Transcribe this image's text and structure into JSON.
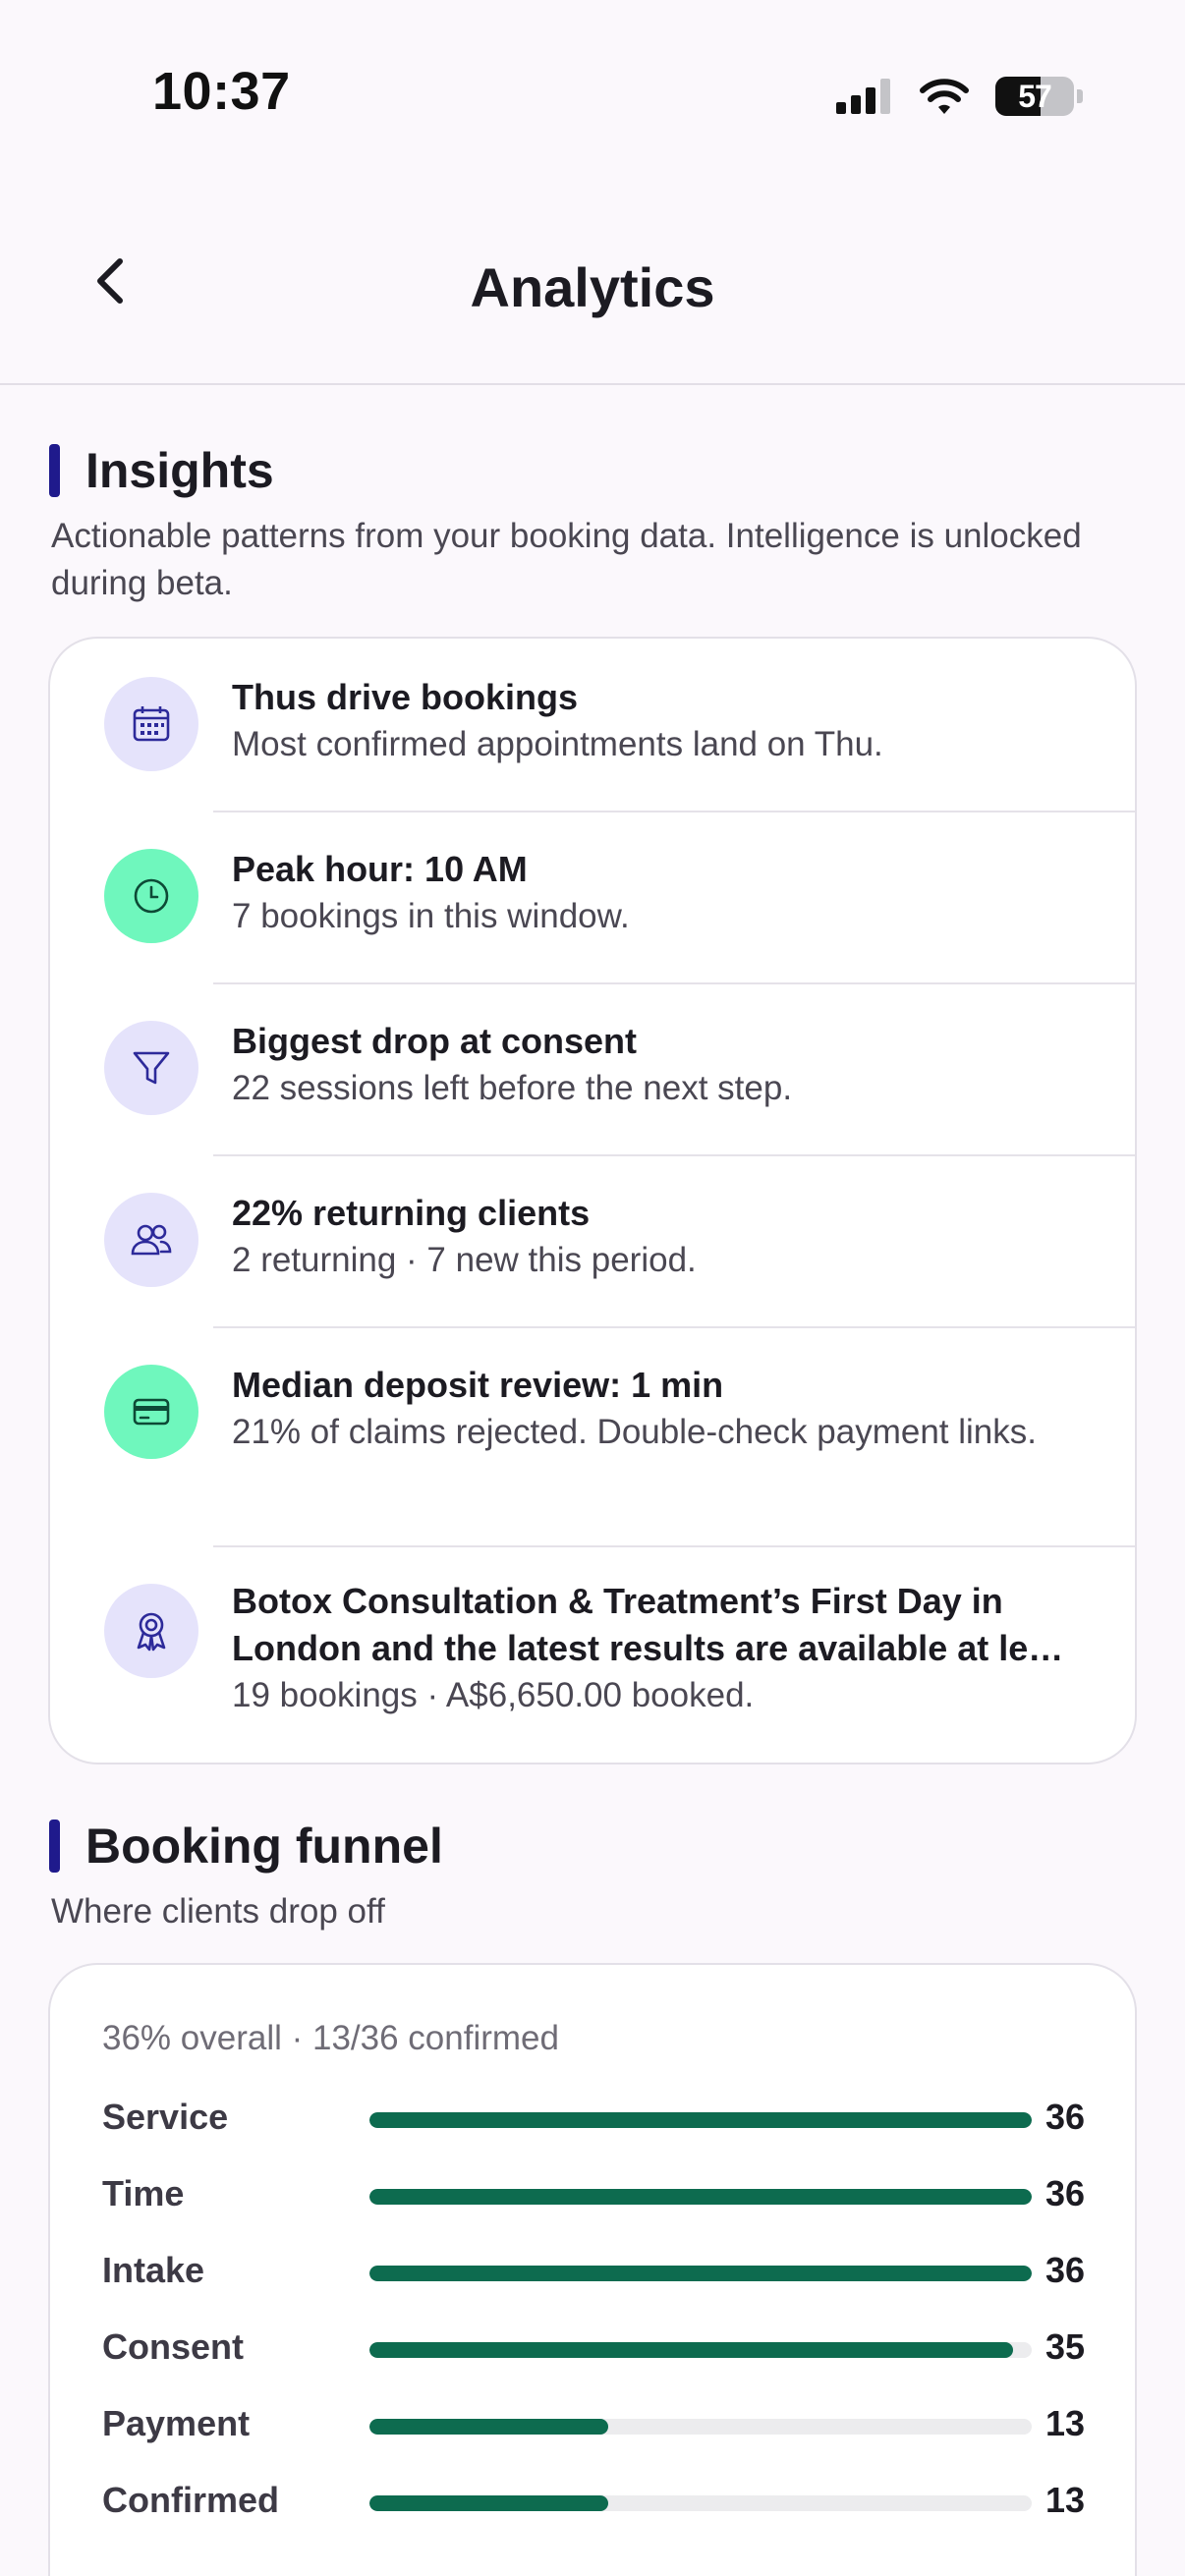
{
  "status_bar": {
    "time": "10:37",
    "battery": "57",
    "battery_level": 57
  },
  "header": {
    "title": "Analytics",
    "back_icon": "chevron-left-icon"
  },
  "insights": {
    "title": "Insights",
    "subtitle": "Actionable patterns from your booking data. Intelligence is unlocked during beta.",
    "items": [
      {
        "icon": "calendar-icon",
        "icon_bg": "lavender",
        "title": "Thus drive bookings",
        "body": "Most confirmed appointments land on Thu."
      },
      {
        "icon": "clock-icon",
        "icon_bg": "mint",
        "title": "Peak hour: 10 AM",
        "body": "7 bookings in this window."
      },
      {
        "icon": "funnel-icon",
        "icon_bg": "lavender",
        "title": "Biggest drop at consent",
        "body": "22 sessions left before the next step."
      },
      {
        "icon": "users-icon",
        "icon_bg": "lavender",
        "title": "22% returning clients",
        "body": "2 returning · 7 new this period."
      },
      {
        "icon": "credit-card-icon",
        "icon_bg": "mint",
        "title": "Median deposit review: 1 min",
        "body": "21% of claims rejected. Double-check payment links."
      },
      {
        "icon": "award-icon",
        "icon_bg": "lavender",
        "title": "Botox Consultation & Treatment’s First Day in London and the latest results are available at le…",
        "body": "19 bookings · A$6,650.00 booked."
      }
    ]
  },
  "funnel": {
    "title": "Booking funnel",
    "subtitle": "Where clients drop off",
    "summary": "36% overall · 13/36 confirmed",
    "max": 36,
    "steps": [
      {
        "label": "Service",
        "value": 36
      },
      {
        "label": "Time",
        "value": 36
      },
      {
        "label": "Intake",
        "value": 36
      },
      {
        "label": "Consent",
        "value": 35
      },
      {
        "label": "Payment",
        "value": 13
      },
      {
        "label": "Confirmed",
        "value": 13
      }
    ]
  },
  "colors": {
    "accent": "#1f1a8c",
    "bar": "#0d6b4f",
    "mint": "#6ff7bd",
    "lavender": "#e5e3fb"
  }
}
